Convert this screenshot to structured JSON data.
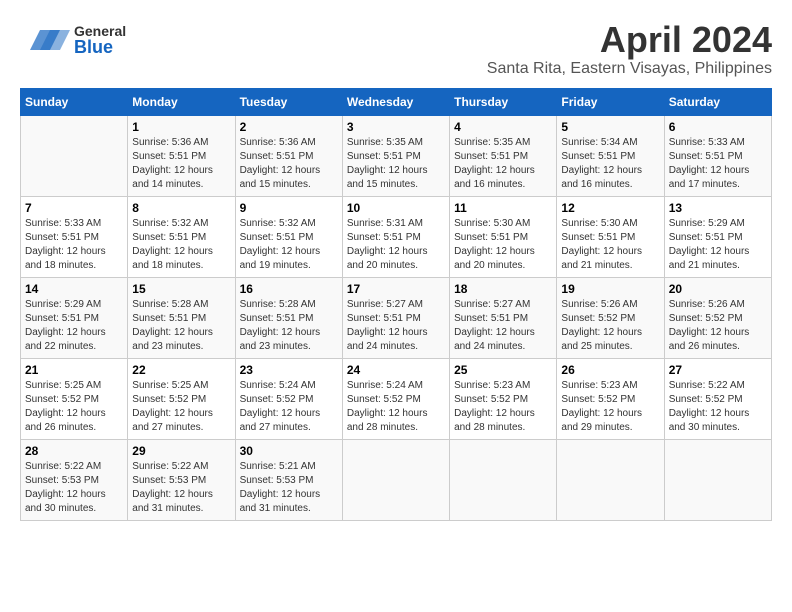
{
  "header": {
    "logo_general": "General",
    "logo_blue": "Blue",
    "month": "April 2024",
    "location": "Santa Rita, Eastern Visayas, Philippines"
  },
  "calendar": {
    "days_of_week": [
      "Sunday",
      "Monday",
      "Tuesday",
      "Wednesday",
      "Thursday",
      "Friday",
      "Saturday"
    ],
    "weeks": [
      [
        {
          "day": "",
          "info": ""
        },
        {
          "day": "1",
          "info": "Sunrise: 5:36 AM\nSunset: 5:51 PM\nDaylight: 12 hours\nand 14 minutes."
        },
        {
          "day": "2",
          "info": "Sunrise: 5:36 AM\nSunset: 5:51 PM\nDaylight: 12 hours\nand 15 minutes."
        },
        {
          "day": "3",
          "info": "Sunrise: 5:35 AM\nSunset: 5:51 PM\nDaylight: 12 hours\nand 15 minutes."
        },
        {
          "day": "4",
          "info": "Sunrise: 5:35 AM\nSunset: 5:51 PM\nDaylight: 12 hours\nand 16 minutes."
        },
        {
          "day": "5",
          "info": "Sunrise: 5:34 AM\nSunset: 5:51 PM\nDaylight: 12 hours\nand 16 minutes."
        },
        {
          "day": "6",
          "info": "Sunrise: 5:33 AM\nSunset: 5:51 PM\nDaylight: 12 hours\nand 17 minutes."
        }
      ],
      [
        {
          "day": "7",
          "info": "Sunrise: 5:33 AM\nSunset: 5:51 PM\nDaylight: 12 hours\nand 18 minutes."
        },
        {
          "day": "8",
          "info": "Sunrise: 5:32 AM\nSunset: 5:51 PM\nDaylight: 12 hours\nand 18 minutes."
        },
        {
          "day": "9",
          "info": "Sunrise: 5:32 AM\nSunset: 5:51 PM\nDaylight: 12 hours\nand 19 minutes."
        },
        {
          "day": "10",
          "info": "Sunrise: 5:31 AM\nSunset: 5:51 PM\nDaylight: 12 hours\nand 20 minutes."
        },
        {
          "day": "11",
          "info": "Sunrise: 5:30 AM\nSunset: 5:51 PM\nDaylight: 12 hours\nand 20 minutes."
        },
        {
          "day": "12",
          "info": "Sunrise: 5:30 AM\nSunset: 5:51 PM\nDaylight: 12 hours\nand 21 minutes."
        },
        {
          "day": "13",
          "info": "Sunrise: 5:29 AM\nSunset: 5:51 PM\nDaylight: 12 hours\nand 21 minutes."
        }
      ],
      [
        {
          "day": "14",
          "info": "Sunrise: 5:29 AM\nSunset: 5:51 PM\nDaylight: 12 hours\nand 22 minutes."
        },
        {
          "day": "15",
          "info": "Sunrise: 5:28 AM\nSunset: 5:51 PM\nDaylight: 12 hours\nand 23 minutes."
        },
        {
          "day": "16",
          "info": "Sunrise: 5:28 AM\nSunset: 5:51 PM\nDaylight: 12 hours\nand 23 minutes."
        },
        {
          "day": "17",
          "info": "Sunrise: 5:27 AM\nSunset: 5:51 PM\nDaylight: 12 hours\nand 24 minutes."
        },
        {
          "day": "18",
          "info": "Sunrise: 5:27 AM\nSunset: 5:51 PM\nDaylight: 12 hours\nand 24 minutes."
        },
        {
          "day": "19",
          "info": "Sunrise: 5:26 AM\nSunset: 5:52 PM\nDaylight: 12 hours\nand 25 minutes."
        },
        {
          "day": "20",
          "info": "Sunrise: 5:26 AM\nSunset: 5:52 PM\nDaylight: 12 hours\nand 26 minutes."
        }
      ],
      [
        {
          "day": "21",
          "info": "Sunrise: 5:25 AM\nSunset: 5:52 PM\nDaylight: 12 hours\nand 26 minutes."
        },
        {
          "day": "22",
          "info": "Sunrise: 5:25 AM\nSunset: 5:52 PM\nDaylight: 12 hours\nand 27 minutes."
        },
        {
          "day": "23",
          "info": "Sunrise: 5:24 AM\nSunset: 5:52 PM\nDaylight: 12 hours\nand 27 minutes."
        },
        {
          "day": "24",
          "info": "Sunrise: 5:24 AM\nSunset: 5:52 PM\nDaylight: 12 hours\nand 28 minutes."
        },
        {
          "day": "25",
          "info": "Sunrise: 5:23 AM\nSunset: 5:52 PM\nDaylight: 12 hours\nand 28 minutes."
        },
        {
          "day": "26",
          "info": "Sunrise: 5:23 AM\nSunset: 5:52 PM\nDaylight: 12 hours\nand 29 minutes."
        },
        {
          "day": "27",
          "info": "Sunrise: 5:22 AM\nSunset: 5:52 PM\nDaylight: 12 hours\nand 30 minutes."
        }
      ],
      [
        {
          "day": "28",
          "info": "Sunrise: 5:22 AM\nSunset: 5:53 PM\nDaylight: 12 hours\nand 30 minutes."
        },
        {
          "day": "29",
          "info": "Sunrise: 5:22 AM\nSunset: 5:53 PM\nDaylight: 12 hours\nand 31 minutes."
        },
        {
          "day": "30",
          "info": "Sunrise: 5:21 AM\nSunset: 5:53 PM\nDaylight: 12 hours\nand 31 minutes."
        },
        {
          "day": "",
          "info": ""
        },
        {
          "day": "",
          "info": ""
        },
        {
          "day": "",
          "info": ""
        },
        {
          "day": "",
          "info": ""
        }
      ]
    ]
  }
}
